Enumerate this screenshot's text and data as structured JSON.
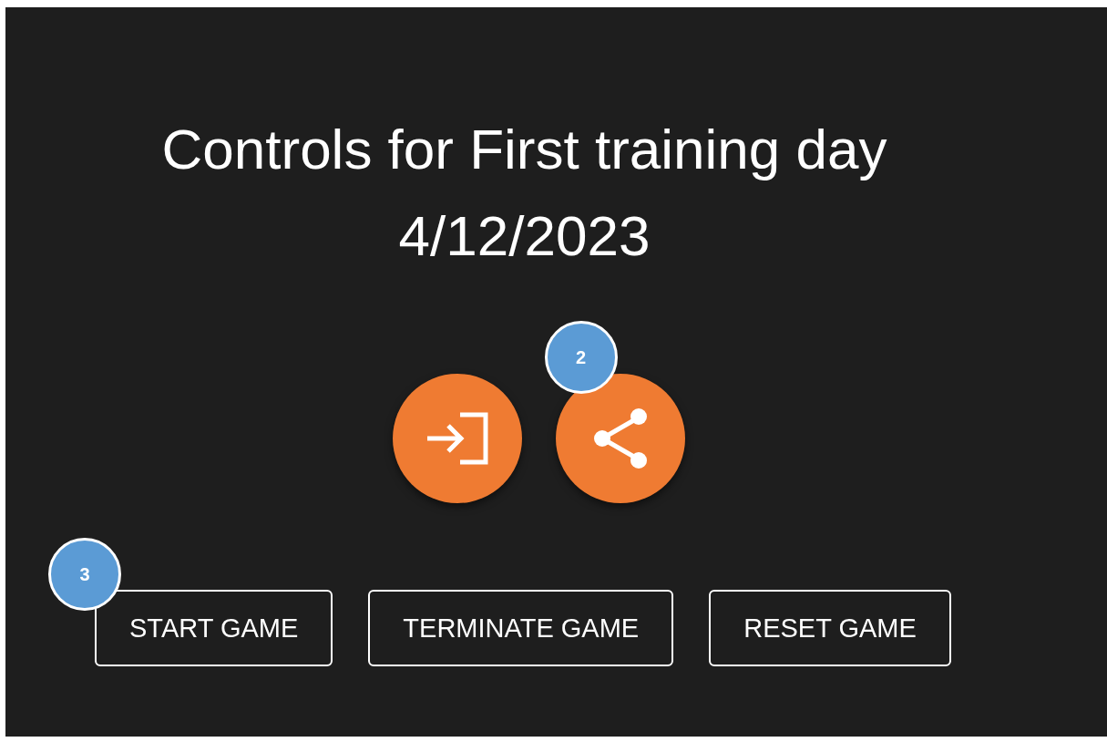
{
  "title": "Controls for First training day 4/12/2023",
  "actions": [
    {
      "kind": "enter"
    },
    {
      "kind": "share",
      "badge": "2"
    }
  ],
  "buttons": [
    {
      "label": "START GAME",
      "badge": "3"
    },
    {
      "label": "TERMINATE GAME"
    },
    {
      "label": "RESET GAME"
    }
  ]
}
